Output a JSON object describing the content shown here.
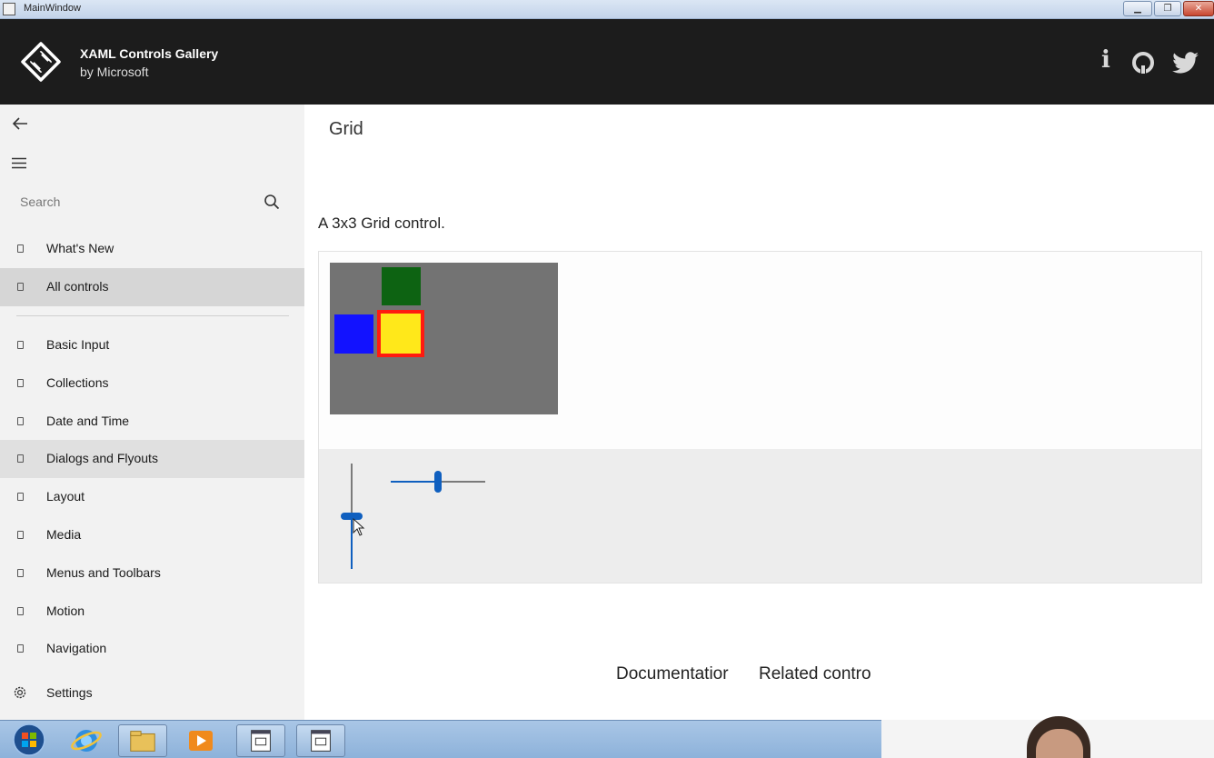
{
  "window": {
    "title": "MainWindow"
  },
  "header": {
    "title": "XAML Controls Gallery",
    "subtitle": "by Microsoft"
  },
  "sidebar": {
    "search_placeholder": "Search",
    "items": [
      {
        "label": "What's New"
      },
      {
        "label": "All controls"
      },
      {
        "label": "Basic Input"
      },
      {
        "label": "Collections"
      },
      {
        "label": "Date and Time"
      },
      {
        "label": "Dialogs and Flyouts"
      },
      {
        "label": "Layout"
      },
      {
        "label": "Media"
      },
      {
        "label": "Menus and Toolbars"
      },
      {
        "label": "Motion"
      },
      {
        "label": "Navigation"
      }
    ],
    "settings_label": "Settings"
  },
  "content": {
    "page_title": "Grid",
    "description": "A 3x3 Grid control.",
    "documentation_link": "Documentatior",
    "related_link": "Related contro"
  },
  "colors": {
    "grid_background": "#737373",
    "cell_green": "#0d6312",
    "cell_blue": "#1212ff",
    "cell_yellow": "#ffe81a",
    "cell_border_red": "#ff1b10",
    "slider_accent": "#0f5fbf"
  },
  "sliders": {
    "vertical_value": 0.5,
    "horizontal_value": 0.5
  },
  "taskbar": {
    "items": [
      "start-orb-icon",
      "internet-explorer-icon",
      "file-explorer-icon",
      "media-player-icon",
      "app-window-icon",
      "app-window-icon"
    ]
  }
}
